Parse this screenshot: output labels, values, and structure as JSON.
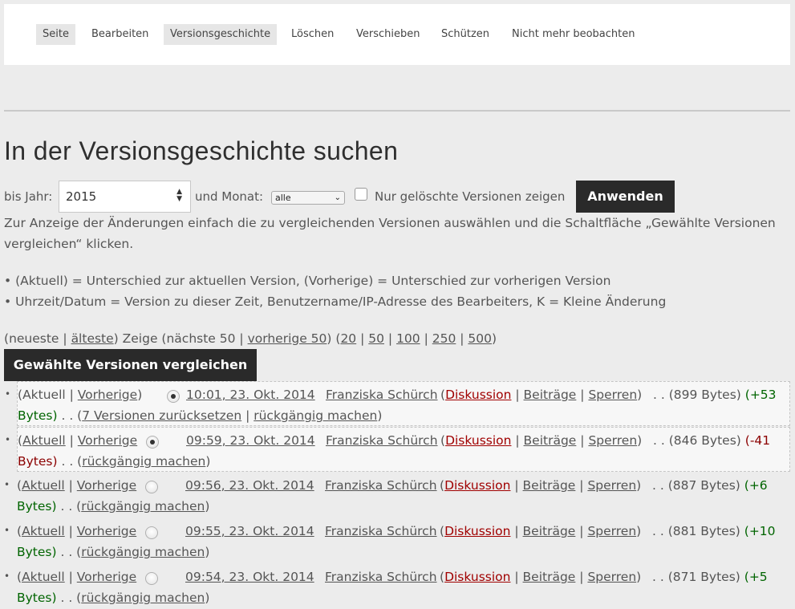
{
  "tabs": [
    {
      "label": "Seite",
      "active": true
    },
    {
      "label": "Bearbeiten",
      "active": false
    },
    {
      "label": "Versionsgeschichte",
      "active": true
    },
    {
      "label": "Löschen",
      "active": false
    },
    {
      "label": "Verschieben",
      "active": false
    },
    {
      "label": "Schützen",
      "active": false
    },
    {
      "label": "Nicht mehr beobachten",
      "active": false
    }
  ],
  "page_title": "In der Versionsgeschichte suchen",
  "filter": {
    "year_label": "bis Jahr:",
    "year_value": "2015",
    "month_label": "und Monat:",
    "month_value": "alle",
    "deleted_label": "Nur gelöschte Versionen zeigen",
    "apply_label": "Anwenden"
  },
  "help_text": "Zur Anzeige der Änderungen einfach die zu vergleichenden Versionen auswählen und die Schaltfläche „Gewählte Versionen vergleichen“ klicken.",
  "legend": [
    "(Aktuell) = Unterschied zur aktuellen Version, (Vorherige) = Unterschied zur vorherigen Version",
    "Uhrzeit/Datum = Version zu dieser Zeit, Benutzername/IP-Adresse des Bearbeiters, K = Kleine Änderung"
  ],
  "nav": {
    "newest": "neueste",
    "oldest": "älteste",
    "show": "Zeige",
    "next": "nächste 50",
    "prev": "vorherige 50",
    "limits": [
      "20",
      "50",
      "100",
      "250",
      "500"
    ]
  },
  "compare_label": "Gewählte Versionen vergleichen",
  "link_labels": {
    "current": "Aktuell",
    "previous": "Vorherige",
    "talk": "Diskussion",
    "contribs": "Beiträge",
    "block": "Sperren",
    "undo": "rückgängig machen"
  },
  "revisions": [
    {
      "timestamp": "10:01, 23. Okt. 2014",
      "user": "Franziska Schürch",
      "size": "(899 Bytes)",
      "diff_a": "(+53",
      "diff_b": "Bytes)",
      "sign": "pos",
      "rollback": "7 Versionen zurücksetzen",
      "current_linked": false,
      "radio_left": false,
      "radio_right": true
    },
    {
      "timestamp": "09:59, 23. Okt. 2014",
      "user": "Franziska Schürch",
      "size": "(846 Bytes)",
      "diff_a": "(-41",
      "diff_b": "Bytes)",
      "sign": "neg",
      "rollback": "",
      "current_linked": true,
      "radio_left": true,
      "radio_right": false
    },
    {
      "timestamp": "09:56, 23. Okt. 2014",
      "user": "Franziska Schürch",
      "size": "(887 Bytes)",
      "diff_a": "(+6",
      "diff_b": "Bytes)",
      "sign": "pos",
      "rollback": "",
      "current_linked": true,
      "radio_left": false,
      "radio_right": false
    },
    {
      "timestamp": "09:55, 23. Okt. 2014",
      "user": "Franziska Schürch",
      "size": "(881 Bytes)",
      "diff_a": "(+10",
      "diff_b": "Bytes)",
      "sign": "pos",
      "rollback": "",
      "current_linked": true,
      "radio_left": false,
      "radio_right": false
    },
    {
      "timestamp": "09:54, 23. Okt. 2014",
      "user": "Franziska Schürch",
      "size": "(871 Bytes)",
      "diff_a": "(+5",
      "diff_b": "Bytes)",
      "sign": "pos",
      "rollback": "",
      "current_linked": true,
      "radio_left": false,
      "radio_right": false
    }
  ]
}
